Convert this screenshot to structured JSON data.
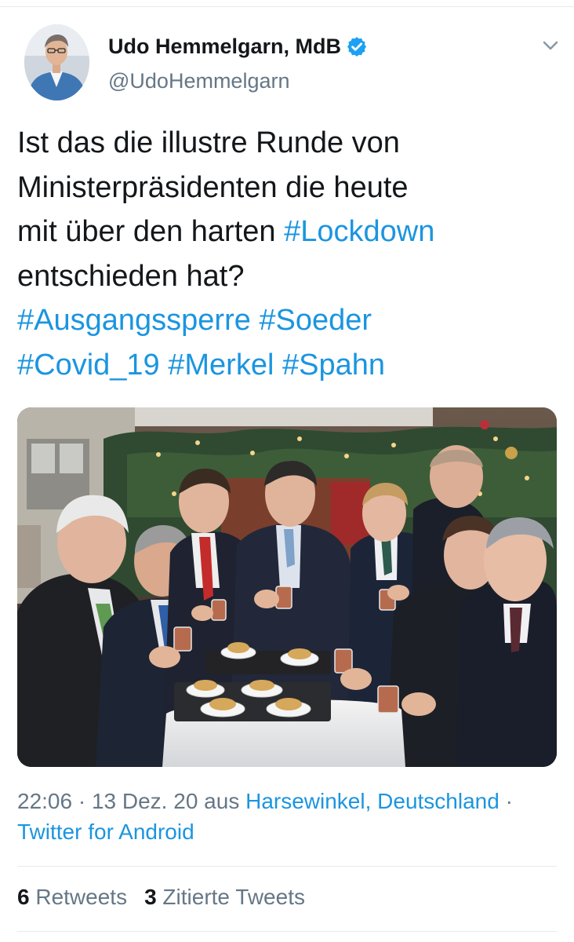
{
  "author": {
    "display_name": "Udo Hemmelgarn, MdB",
    "handle": "@UdoHemmelgarn",
    "verified_icon": "verified-badge-icon"
  },
  "menu": {
    "icon": "chevron-down-icon"
  },
  "tweet": {
    "lines": [
      [
        "Ist das die illustre Runde von"
      ],
      [
        "Ministerpräsidenten die heute"
      ],
      [
        "mit über den harten ",
        "#Lockdown"
      ],
      [
        "entschieden hat?"
      ],
      [
        "#Ausgangssperre",
        " ",
        "#Soeder"
      ],
      [
        "#Covid_19",
        " ",
        "#Merkel",
        " ",
        "#Spahn"
      ]
    ],
    "text_line_1": "Ist das die illustre Runde von",
    "text_line_2": "Ministerpräsidenten die heute",
    "text_line_3_prefix": "mit über den harten ",
    "hashtag_lockdown": "#Lockdown",
    "text_line_4": "entschieden hat?",
    "hashtag_ausgangssperre": "#Ausgangssperre",
    "hashtag_soeder": "#Soeder",
    "hashtag_covid": "#Covid_19",
    "hashtag_merkel": "#Merkel",
    "hashtag_spahn": "#Spahn"
  },
  "meta": {
    "time": "22:06",
    "separator": " · ",
    "date": "13 Dez. 20",
    "location_prefix": " aus ",
    "location": "Harsewinkel, Deutschland",
    "trailing_separator": " ·",
    "source": "Twitter for Android"
  },
  "stats": {
    "retweets_count": "6",
    "retweets_label": " Retweets",
    "quotes_count": "3",
    "quotes_label": " Zitierte Tweets"
  },
  "colors": {
    "link": "#1b95e0",
    "text": "#14171a",
    "muted": "#657786",
    "verified": "#1da1f2"
  }
}
